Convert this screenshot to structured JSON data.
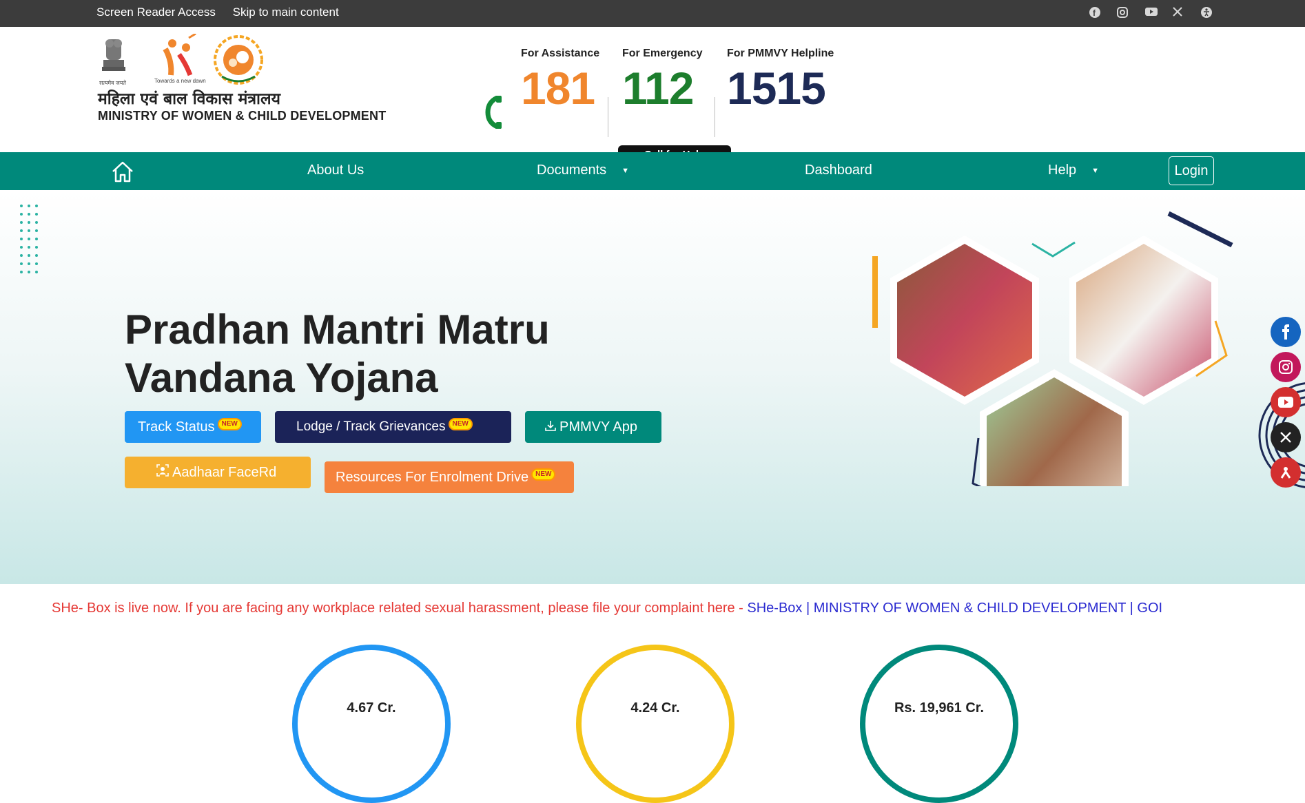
{
  "topbar": {
    "screen_reader": "Screen Reader Access",
    "skip": "Skip to main content",
    "icons": [
      "facebook-icon",
      "instagram-icon",
      "youtube-icon",
      "x-icon",
      "accessibility-icon"
    ]
  },
  "header": {
    "logo_caption_1": "सत्यमेव जयते",
    "logo_caption_2": "Towards a new dawn",
    "hindi_name": "महिला एवं बाल विकास मंत्रालय",
    "ministry_name": "MINISTRY OF WOMEN & CHILD DEVELOPMENT",
    "helplines": [
      {
        "label": "For Assistance",
        "number": "181"
      },
      {
        "label": "For Emergency",
        "number": "112"
      },
      {
        "label": "For PMMVY Helpline",
        "number": "1515"
      }
    ],
    "call_for_help": "Call for Help"
  },
  "nav": {
    "about": "About Us",
    "documents": "Documents",
    "dashboard": "Dashboard",
    "help": "Help",
    "login": "Login"
  },
  "hero": {
    "title_line1": "Pradhan Mantri Matru",
    "title_line2": "Vandana Yojana",
    "new_badge": "NEW",
    "buttons": {
      "track": "Track Status",
      "lodge": "Lodge / Track Grievances",
      "app": "PMMVY App",
      "aadhaar": "Aadhaar FaceRd",
      "resources": "Resources For Enrolment Drive"
    }
  },
  "marquee": {
    "text": "SHe- Box is live now. If you are facing any workplace related sexual harassment, please file your complaint here - ",
    "link": "SHe-Box | MINISTRY OF WOMEN & CHILD DEVELOPMENT | GOI"
  },
  "stats": {
    "s1": "4.67 Cr.",
    "s2": "4.24 Cr.",
    "s3": "Rs. 19,961 Cr."
  },
  "colors": {
    "nav": "#00897b",
    "topbar": "#3c3c3c",
    "n181": "#f0862d",
    "n112": "#1d7e2d",
    "n1515": "#1d2a56"
  }
}
